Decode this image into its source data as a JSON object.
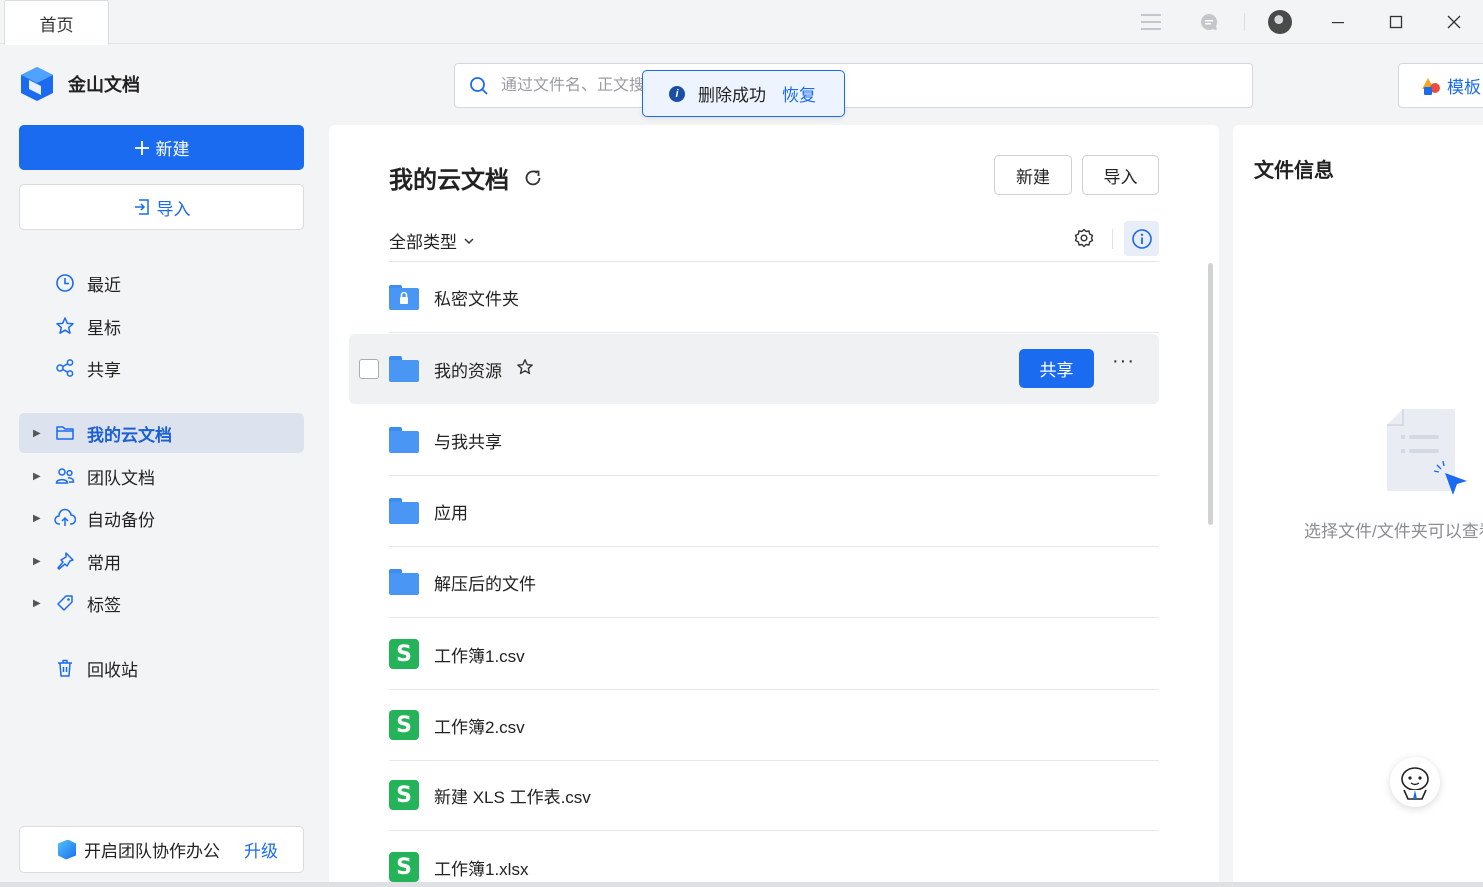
{
  "titlebar": {
    "home_tab": "首页"
  },
  "sidebar": {
    "logo_text": "金山文档",
    "new_label": "新建",
    "import_label": "导入",
    "quick_items": [
      {
        "label": "最近",
        "icon": "clock-icon"
      },
      {
        "label": "星标",
        "icon": "star-icon"
      },
      {
        "label": "共享",
        "icon": "share-icon"
      }
    ],
    "tree_items": [
      {
        "label": "我的云文档",
        "icon": "folder-icon",
        "active": true
      },
      {
        "label": "团队文档",
        "icon": "team-icon"
      },
      {
        "label": "自动备份",
        "icon": "cloud-backup-icon"
      },
      {
        "label": "常用",
        "icon": "pin-icon"
      },
      {
        "label": "标签",
        "icon": "tag-icon"
      }
    ],
    "trash_label": "回收站",
    "upgrade": {
      "text": "开启团队协作办公",
      "link": "升级"
    }
  },
  "search": {
    "placeholder": "通过文件名、正文搜索"
  },
  "toast": {
    "message": "删除成功",
    "action": "恢复"
  },
  "template_button": "模板",
  "main": {
    "title": "我的云文档",
    "new_btn": "新建",
    "import_btn": "导入",
    "filter_label": "全部类型",
    "share_btn": "共享",
    "files": [
      {
        "name": "私密文件夹",
        "type": "private-folder"
      },
      {
        "name": "我的资源",
        "type": "folder"
      },
      {
        "name": "与我共享",
        "type": "folder"
      },
      {
        "name": "应用",
        "type": "folder"
      },
      {
        "name": "解压后的文件",
        "type": "folder"
      },
      {
        "name": "工作簿1.csv",
        "type": "sheet"
      },
      {
        "name": "工作簿2.csv",
        "type": "sheet"
      },
      {
        "name": "新建 XLS 工作表.csv",
        "type": "sheet"
      },
      {
        "name": "工作簿1.xlsx",
        "type": "sheet"
      }
    ]
  },
  "info_panel": {
    "title": "文件信息",
    "empty_text": "选择文件/文件夹可以查看详细信息"
  },
  "colors": {
    "accent": "#1a6bf0",
    "sheet_green": "#25b35a",
    "folder_blue": "#4a96f5"
  }
}
